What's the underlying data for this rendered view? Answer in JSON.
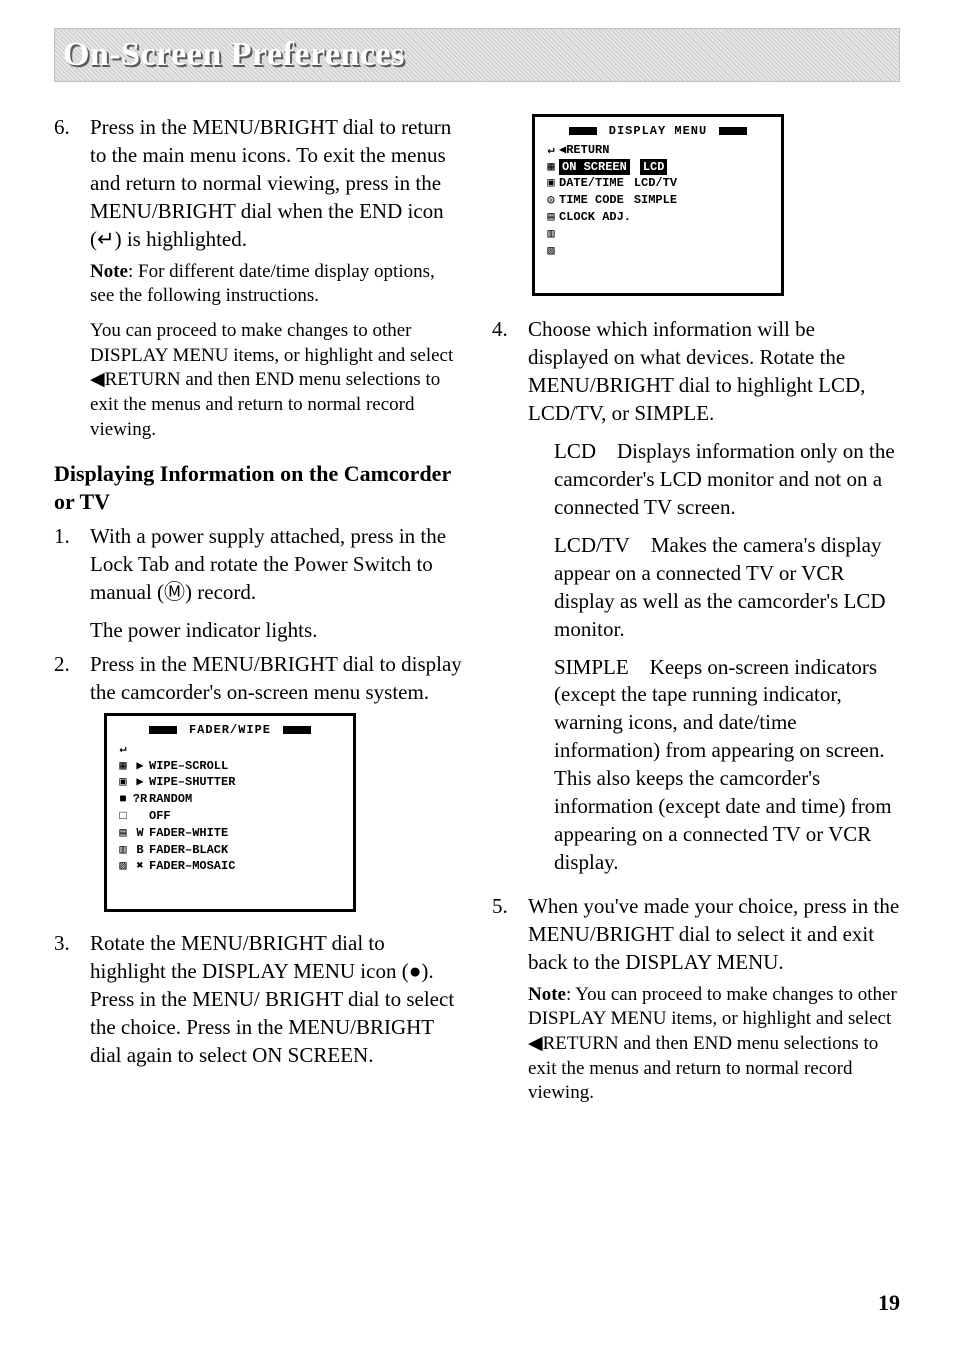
{
  "page_title": "On-Screen Preferences",
  "page_number": "19",
  "left": {
    "step6": {
      "num": "6.",
      "text": "Press in the MENU/BRIGHT dial to return to the main menu icons. To exit the menus and return to normal viewing, press in the MENU/BRIGHT dial when the END icon (↵) is highlighted.",
      "note_label": "Note",
      "note_text": ": For different date/time display options, see the following instructions.",
      "extra": "You can proceed to make changes to other DISPLAY MENU items, or highlight and select ◀RETURN and then END menu selections to exit the menus and return to normal record viewing."
    },
    "heading": "Displaying Information on the Camcorder or TV",
    "step1": {
      "num": "1.",
      "text": "With a power supply attached, press in the Lock Tab and rotate the Power Switch to manual (Ⓜ) record.",
      "after": "The power indicator lights."
    },
    "step2": {
      "num": "2.",
      "text": "Press in the MENU/BRIGHT dial to display the camcorder's on-screen menu system."
    },
    "fader_box": {
      "title": "FADER/WIPE",
      "rows": [
        {
          "icon": "↵",
          "mid": "",
          "text": ""
        },
        {
          "icon": "▦",
          "mid": "▶",
          "text": "WIPE–SCROLL"
        },
        {
          "icon": "▣",
          "mid": "▶",
          "text": "WIPE–SHUTTER"
        },
        {
          "icon": "■",
          "mid": "?R",
          "text": "RANDOM"
        },
        {
          "icon": "□",
          "mid": "",
          "text": "OFF"
        },
        {
          "icon": "▤",
          "mid": "W",
          "text": "FADER–WHITE"
        },
        {
          "icon": "▥",
          "mid": "B",
          "text": "FADER–BLACK"
        },
        {
          "icon": "▨",
          "mid": "✖",
          "text": "FADER–MOSAIC"
        }
      ]
    },
    "step3": {
      "num": "3.",
      "text": "Rotate the MENU/BRIGHT dial to highlight the DISPLAY MENU icon (●). Press in the MENU/ BRIGHT dial to select the choice. Press in the MENU/BRIGHT dial again to select ON SCREEN."
    }
  },
  "right": {
    "display_menu": {
      "title": "DISPLAY MENU",
      "rows": [
        {
          "icon": "↵",
          "mid": "◀RETURN",
          "right": ""
        },
        {
          "icon": "▦",
          "mid_inv": "ON SCREEN",
          "right_inv": "LCD"
        },
        {
          "icon": "▣",
          "mid": "DATE/TIME",
          "right": "LCD/TV"
        },
        {
          "icon": "◎",
          "mid": "TIME CODE",
          "right": "SIMPLE"
        },
        {
          "icon": "▤",
          "mid": "CLOCK ADJ.",
          "right": ""
        },
        {
          "icon": "▥",
          "mid": "",
          "right": ""
        },
        {
          "icon": "▨",
          "mid": "",
          "right": ""
        }
      ]
    },
    "step4": {
      "num": "4.",
      "text": "Choose which information will be displayed on what devices. Rotate the MENU/BRIGHT dial to highlight LCD, LCD/TV, or SIMPLE.",
      "opt_lcd": "LCD Displays information only on the camcorder's LCD monitor and not on a connected TV screen.",
      "opt_lcdtv": "LCD/TV Makes the camera's display appear on a connected TV or VCR display as well as the camcorder's LCD monitor.",
      "opt_simple": "SIMPLE Keeps on-screen indicators (except the tape running indicator, warning icons, and date/time information) from appearing on screen. This also keeps the camcorder's information (except date and time) from appearing on a connected TV or VCR display."
    },
    "step5": {
      "num": "5.",
      "text": "When you've made your choice, press in the MENU/BRIGHT dial to select it and exit back to the DISPLAY MENU.",
      "note_label": "Note",
      "note_text": ": You can proceed to make changes to other DISPLAY MENU items, or highlight and select ◀RETURN and then END menu selections to exit the menus and return to normal record viewing."
    }
  }
}
